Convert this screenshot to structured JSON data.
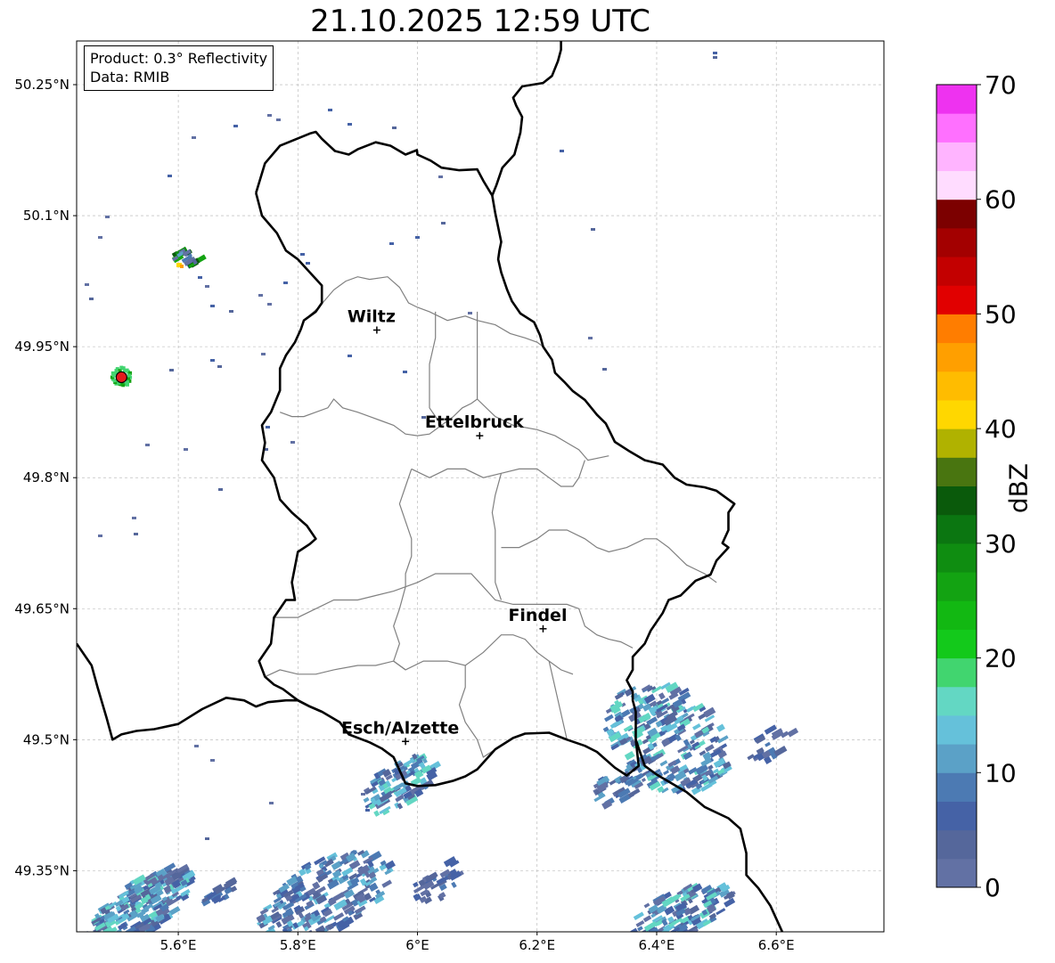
{
  "title": "21.10.2025 12:59 UTC",
  "info": {
    "product": "Product: 0.3° Reflectivity",
    "source": "Data: RMIB"
  },
  "map": {
    "lon_range": [
      5.43,
      6.78
    ],
    "lat_range": [
      49.28,
      50.3
    ],
    "lon_ticks": [
      {
        "value": 5.6,
        "label": "5.6°E"
      },
      {
        "value": 5.8,
        "label": "5.8°E"
      },
      {
        "value": 6.0,
        "label": "6°E"
      },
      {
        "value": 6.2,
        "label": "6.2°E"
      },
      {
        "value": 6.4,
        "label": "6.4°E"
      },
      {
        "value": 6.6,
        "label": "6.6°E"
      }
    ],
    "lat_ticks": [
      {
        "value": 50.25,
        "label": "50.25°N"
      },
      {
        "value": 50.1,
        "label": "50.1°N"
      },
      {
        "value": 49.95,
        "label": "49.95°N"
      },
      {
        "value": 49.8,
        "label": "49.8°N"
      },
      {
        "value": 49.65,
        "label": "49.65°N"
      },
      {
        "value": 49.5,
        "label": "49.5°N"
      },
      {
        "value": 49.35,
        "label": "49.35°N"
      }
    ],
    "cities": [
      {
        "name": "Wiltz",
        "lon": 5.932,
        "lat": 49.969
      },
      {
        "name": "Ettelbruck",
        "lon": 6.104,
        "lat": 49.848
      },
      {
        "name": "Findel",
        "lon": 6.21,
        "lat": 49.627
      },
      {
        "name": "Esch/Alzette",
        "lon": 5.98,
        "lat": 49.498
      }
    ],
    "radar_site": {
      "lon": 5.505,
      "lat": 49.915,
      "color": "#e31a1c"
    },
    "border_color": "#000000",
    "canton_color": "#808080",
    "grid": true,
    "national_border": [
      [
        5.73,
        50.126
      ],
      [
        5.745,
        50.16
      ],
      [
        5.77,
        50.18
      ],
      [
        5.82,
        50.194
      ],
      [
        5.83,
        50.196
      ],
      [
        5.84,
        50.188
      ],
      [
        5.862,
        50.174
      ],
      [
        5.885,
        50.17
      ],
      [
        5.9,
        50.176
      ],
      [
        5.93,
        50.184
      ],
      [
        5.955,
        50.18
      ],
      [
        5.98,
        50.17
      ],
      [
        5.999,
        50.175
      ],
      [
        6.0,
        50.17
      ],
      [
        6.022,
        50.163
      ],
      [
        6.04,
        50.155
      ],
      [
        6.07,
        50.152
      ],
      [
        6.1,
        50.153
      ],
      [
        6.11,
        50.14
      ],
      [
        6.125,
        50.123
      ],
      [
        6.13,
        50.103
      ],
      [
        6.14,
        50.07
      ],
      [
        6.137,
        50.06
      ],
      [
        6.135,
        50.05
      ],
      [
        6.14,
        50.035
      ],
      [
        6.15,
        50.015
      ],
      [
        6.158,
        50.002
      ],
      [
        6.172,
        49.988
      ],
      [
        6.195,
        49.978
      ],
      [
        6.205,
        49.963
      ],
      [
        6.21,
        49.95
      ],
      [
        6.225,
        49.935
      ],
      [
        6.23,
        49.92
      ],
      [
        6.245,
        49.91
      ],
      [
        6.26,
        49.899
      ],
      [
        6.28,
        49.889
      ],
      [
        6.3,
        49.872
      ],
      [
        6.315,
        49.862
      ],
      [
        6.32,
        49.855
      ],
      [
        6.33,
        49.841
      ],
      [
        6.355,
        49.83
      ],
      [
        6.38,
        49.82
      ],
      [
        6.41,
        49.815
      ],
      [
        6.43,
        49.8
      ],
      [
        6.45,
        49.792
      ],
      [
        6.48,
        49.789
      ],
      [
        6.5,
        49.785
      ],
      [
        6.53,
        49.77
      ],
      [
        6.52,
        49.76
      ],
      [
        6.52,
        49.74
      ],
      [
        6.51,
        49.725
      ],
      [
        6.52,
        49.72
      ],
      [
        6.5,
        49.705
      ],
      [
        6.49,
        49.689
      ],
      [
        6.465,
        49.682
      ],
      [
        6.44,
        49.665
      ],
      [
        6.42,
        49.66
      ],
      [
        6.41,
        49.645
      ],
      [
        6.39,
        49.625
      ],
      [
        6.38,
        49.61
      ],
      [
        6.36,
        49.595
      ],
      [
        6.36,
        49.58
      ],
      [
        6.35,
        49.568
      ],
      [
        6.36,
        49.555
      ],
      [
        6.36,
        49.545
      ],
      [
        6.365,
        49.532
      ],
      [
        6.365,
        49.5
      ],
      [
        6.37,
        49.47
      ],
      [
        6.35,
        49.459
      ],
      [
        6.33,
        49.468
      ],
      [
        6.3,
        49.486
      ],
      [
        6.28,
        49.493
      ],
      [
        6.25,
        49.5
      ],
      [
        6.22,
        49.508
      ],
      [
        6.18,
        49.507
      ],
      [
        6.16,
        49.502
      ],
      [
        6.13,
        49.489
      ],
      [
        6.1,
        49.466
      ],
      [
        6.08,
        49.458
      ],
      [
        6.06,
        49.453
      ],
      [
        6.03,
        49.448
      ],
      [
        6.0,
        49.447
      ],
      [
        5.98,
        49.45
      ],
      [
        5.96,
        49.48
      ],
      [
        5.94,
        49.49
      ],
      [
        5.92,
        49.497
      ],
      [
        5.885,
        49.506
      ],
      [
        5.87,
        49.52
      ],
      [
        5.84,
        49.532
      ],
      [
        5.82,
        49.538
      ],
      [
        5.8,
        49.545
      ],
      [
        5.775,
        49.558
      ],
      [
        5.76,
        49.563
      ],
      [
        5.745,
        49.572
      ],
      [
        5.735,
        49.59
      ],
      [
        5.755,
        49.61
      ],
      [
        5.76,
        49.64
      ],
      [
        5.78,
        49.66
      ],
      [
        5.795,
        49.66
      ],
      [
        5.79,
        49.68
      ],
      [
        5.8,
        49.715
      ],
      [
        5.82,
        49.724
      ],
      [
        5.83,
        49.73
      ],
      [
        5.815,
        49.745
      ],
      [
        5.79,
        49.76
      ],
      [
        5.77,
        49.775
      ],
      [
        5.76,
        49.8
      ],
      [
        5.74,
        49.82
      ],
      [
        5.745,
        49.84
      ],
      [
        5.74,
        49.86
      ],
      [
        5.755,
        49.875
      ],
      [
        5.77,
        49.9
      ],
      [
        5.77,
        49.925
      ],
      [
        5.78,
        49.94
      ],
      [
        5.795,
        49.955
      ],
      [
        5.805,
        49.97
      ],
      [
        5.81,
        49.98
      ],
      [
        5.83,
        49.99
      ],
      [
        5.84,
        50.0
      ],
      [
        5.84,
        50.02
      ],
      [
        5.82,
        50.035
      ],
      [
        5.8,
        50.05
      ],
      [
        5.78,
        50.06
      ],
      [
        5.765,
        50.08
      ],
      [
        5.74,
        50.1
      ],
      [
        5.73,
        50.126
      ]
    ],
    "german_border": [
      [
        6.125,
        50.123
      ],
      [
        6.132,
        50.135
      ],
      [
        6.142,
        50.155
      ],
      [
        6.162,
        50.17
      ],
      [
        6.172,
        50.195
      ],
      [
        6.175,
        50.213
      ],
      [
        6.165,
        50.226
      ],
      [
        6.16,
        50.235
      ],
      [
        6.175,
        50.248
      ],
      [
        6.21,
        50.252
      ],
      [
        6.225,
        50.26
      ],
      [
        6.235,
        50.277
      ],
      [
        6.24,
        50.29
      ],
      [
        6.24,
        50.3
      ]
    ],
    "french_belgian_border": [
      [
        5.43,
        49.61
      ],
      [
        5.455,
        49.585
      ],
      [
        5.465,
        49.56
      ],
      [
        5.48,
        49.525
      ],
      [
        5.49,
        49.5
      ],
      [
        5.505,
        49.506
      ],
      [
        5.53,
        49.51
      ],
      [
        5.56,
        49.512
      ],
      [
        5.6,
        49.518
      ],
      [
        5.64,
        49.535
      ],
      [
        5.68,
        49.548
      ],
      [
        5.71,
        49.545
      ],
      [
        5.73,
        49.538
      ],
      [
        5.75,
        49.543
      ],
      [
        5.78,
        49.545
      ],
      [
        5.8,
        49.545
      ],
      [
        5.82,
        49.538
      ],
      [
        5.84,
        49.532
      ]
    ],
    "moselle_line": [
      [
        6.365,
        49.5
      ],
      [
        6.38,
        49.47
      ],
      [
        6.4,
        49.46
      ],
      [
        6.42,
        49.452
      ],
      [
        6.45,
        49.44
      ],
      [
        6.48,
        49.423
      ],
      [
        6.52,
        49.41
      ],
      [
        6.54,
        49.398
      ],
      [
        6.55,
        49.37
      ],
      [
        6.55,
        49.345
      ],
      [
        6.57,
        49.33
      ],
      [
        6.59,
        49.31
      ],
      [
        6.6,
        49.295
      ],
      [
        6.61,
        49.28
      ]
    ],
    "canton_lines": [
      [
        [
          5.81,
          49.98
        ],
        [
          5.835,
          49.995
        ],
        [
          5.86,
          50.015
        ],
        [
          5.88,
          50.025
        ],
        [
          5.9,
          50.03
        ],
        [
          5.92,
          50.027
        ],
        [
          5.95,
          50.03
        ],
        [
          5.97,
          50.018
        ],
        [
          5.985,
          50.0
        ],
        [
          6.0,
          49.995
        ],
        [
          6.02,
          49.99
        ],
        [
          6.05,
          49.98
        ],
        [
          6.08,
          49.985
        ],
        [
          6.1,
          49.98
        ],
        [
          6.13,
          49.975
        ],
        [
          6.155,
          49.965
        ],
        [
          6.18,
          49.96
        ],
        [
          6.2,
          49.955
        ],
        [
          6.21,
          49.95
        ]
      ],
      [
        [
          5.77,
          49.875
        ],
        [
          5.79,
          49.87
        ],
        [
          5.81,
          49.87
        ],
        [
          5.83,
          49.875
        ],
        [
          5.85,
          49.88
        ],
        [
          5.86,
          49.89
        ],
        [
          5.875,
          49.88
        ],
        [
          5.9,
          49.875
        ],
        [
          5.92,
          49.87
        ],
        [
          5.94,
          49.865
        ],
        [
          5.96,
          49.86
        ],
        [
          5.98,
          49.85
        ],
        [
          6.0,
          49.848
        ],
        [
          6.02,
          49.85
        ],
        [
          6.04,
          49.86
        ],
        [
          6.06,
          49.87
        ],
        [
          6.075,
          49.88
        ],
        [
          6.09,
          49.885
        ],
        [
          6.1,
          49.89
        ]
      ],
      [
        [
          6.04,
          49.86
        ],
        [
          6.02,
          49.88
        ],
        [
          6.02,
          49.9
        ],
        [
          6.02,
          49.93
        ],
        [
          6.03,
          49.96
        ],
        [
          6.03,
          49.99
        ]
      ],
      [
        [
          6.1,
          49.89
        ],
        [
          6.1,
          49.92
        ],
        [
          6.1,
          49.96
        ],
        [
          6.1,
          49.99
        ]
      ],
      [
        [
          6.1,
          49.89
        ],
        [
          6.13,
          49.87
        ],
        [
          6.16,
          49.86
        ],
        [
          6.2,
          49.855
        ],
        [
          6.23,
          49.848
        ],
        [
          6.25,
          49.84
        ],
        [
          6.27,
          49.832
        ],
        [
          6.285,
          49.82
        ],
        [
          6.32,
          49.825
        ]
      ],
      [
        [
          5.99,
          49.81
        ],
        [
          6.02,
          49.8
        ],
        [
          6.05,
          49.81
        ],
        [
          6.08,
          49.81
        ],
        [
          6.11,
          49.8
        ],
        [
          6.14,
          49.805
        ],
        [
          6.17,
          49.81
        ],
        [
          6.2,
          49.81
        ],
        [
          6.22,
          49.8
        ],
        [
          6.24,
          49.79
        ],
        [
          6.26,
          49.79
        ],
        [
          6.27,
          49.8
        ],
        [
          6.28,
          49.82
        ]
      ],
      [
        [
          6.14,
          49.805
        ],
        [
          6.13,
          49.78
        ],
        [
          6.125,
          49.76
        ],
        [
          6.13,
          49.74
        ],
        [
          6.13,
          49.72
        ],
        [
          6.13,
          49.7
        ],
        [
          6.13,
          49.68
        ],
        [
          6.14,
          49.66
        ]
      ],
      [
        [
          5.76,
          49.64
        ],
        [
          5.8,
          49.64
        ],
        [
          5.83,
          49.65
        ],
        [
          5.86,
          49.66
        ],
        [
          5.9,
          49.66
        ],
        [
          5.93,
          49.665
        ],
        [
          5.96,
          49.67
        ],
        [
          5.98,
          49.675
        ]
      ],
      [
        [
          5.99,
          49.81
        ],
        [
          5.98,
          49.79
        ],
        [
          5.97,
          49.77
        ],
        [
          5.98,
          49.75
        ],
        [
          5.99,
          49.73
        ],
        [
          5.99,
          49.71
        ],
        [
          5.98,
          49.69
        ],
        [
          5.98,
          49.675
        ]
      ],
      [
        [
          5.98,
          49.675
        ],
        [
          6.0,
          49.68
        ],
        [
          6.03,
          49.69
        ],
        [
          6.06,
          49.69
        ],
        [
          6.09,
          49.69
        ],
        [
          6.11,
          49.675
        ],
        [
          6.13,
          49.66
        ],
        [
          6.16,
          49.655
        ],
        [
          6.2,
          49.655
        ],
        [
          6.23,
          49.655
        ],
        [
          6.25,
          49.655
        ],
        [
          6.27,
          49.65
        ],
        [
          6.28,
          49.63
        ],
        [
          6.3,
          49.62
        ],
        [
          6.32,
          49.615
        ],
        [
          6.34,
          49.612
        ],
        [
          6.36,
          49.605
        ]
      ],
      [
        [
          6.14,
          49.72
        ],
        [
          6.17,
          49.72
        ],
        [
          6.2,
          49.73
        ],
        [
          6.22,
          49.74
        ],
        [
          6.25,
          49.74
        ],
        [
          6.28,
          49.73
        ],
        [
          6.3,
          49.72
        ],
        [
          6.32,
          49.715
        ],
        [
          6.35,
          49.72
        ],
        [
          6.38,
          49.73
        ],
        [
          6.4,
          49.73
        ],
        [
          6.42,
          49.72
        ],
        [
          6.45,
          49.7
        ],
        [
          6.48,
          49.69
        ],
        [
          6.5,
          49.68
        ]
      ],
      [
        [
          5.98,
          49.675
        ],
        [
          5.97,
          49.65
        ],
        [
          5.96,
          49.63
        ],
        [
          5.97,
          49.61
        ],
        [
          5.96,
          49.59
        ],
        [
          5.98,
          49.58
        ]
      ],
      [
        [
          5.745,
          49.572
        ],
        [
          5.77,
          49.58
        ],
        [
          5.8,
          49.575
        ],
        [
          5.83,
          49.575
        ],
        [
          5.86,
          49.58
        ],
        [
          5.9,
          49.585
        ],
        [
          5.93,
          49.585
        ],
        [
          5.96,
          49.59
        ],
        [
          5.98,
          49.58
        ],
        [
          6.01,
          49.59
        ],
        [
          6.05,
          49.59
        ],
        [
          6.08,
          49.585
        ],
        [
          6.11,
          49.6
        ],
        [
          6.14,
          49.62
        ],
        [
          6.16,
          49.62
        ],
        [
          6.18,
          49.615
        ],
        [
          6.2,
          49.6
        ],
        [
          6.22,
          49.59
        ],
        [
          6.24,
          49.58
        ],
        [
          6.26,
          49.575
        ]
      ],
      [
        [
          6.08,
          49.585
        ],
        [
          6.08,
          49.56
        ],
        [
          6.07,
          49.54
        ],
        [
          6.08,
          49.52
        ],
        [
          6.1,
          49.5
        ],
        [
          6.11,
          49.48
        ],
        [
          6.13,
          49.489
        ]
      ],
      [
        [
          6.22,
          49.59
        ],
        [
          6.23,
          49.56
        ],
        [
          6.24,
          49.53
        ],
        [
          6.25,
          49.5
        ]
      ]
    ]
  },
  "colorbar": {
    "label": "dBZ",
    "min": 0,
    "max": 70,
    "step": 2.5,
    "ticks": [
      0,
      10,
      20,
      30,
      40,
      50,
      60,
      70
    ],
    "colors": [
      "#6271a4",
      "#55679b",
      "#4562a6",
      "#4c7ab3",
      "#5ba1c7",
      "#65c1da",
      "#63d7c3",
      "#41d56f",
      "#13c91b",
      "#12b812",
      "#13a312",
      "#0f8d11",
      "#0b7611",
      "#0a5a0b",
      "#497510",
      "#b0b200",
      "#ffd700",
      "#ffbc00",
      "#ff9f00",
      "#ff7d00",
      "#e10000",
      "#c30000",
      "#a30000",
      "#7c0000",
      "#ffdcff",
      "#ffb4ff",
      "#ff70ff",
      "#ee32f0"
    ]
  }
}
